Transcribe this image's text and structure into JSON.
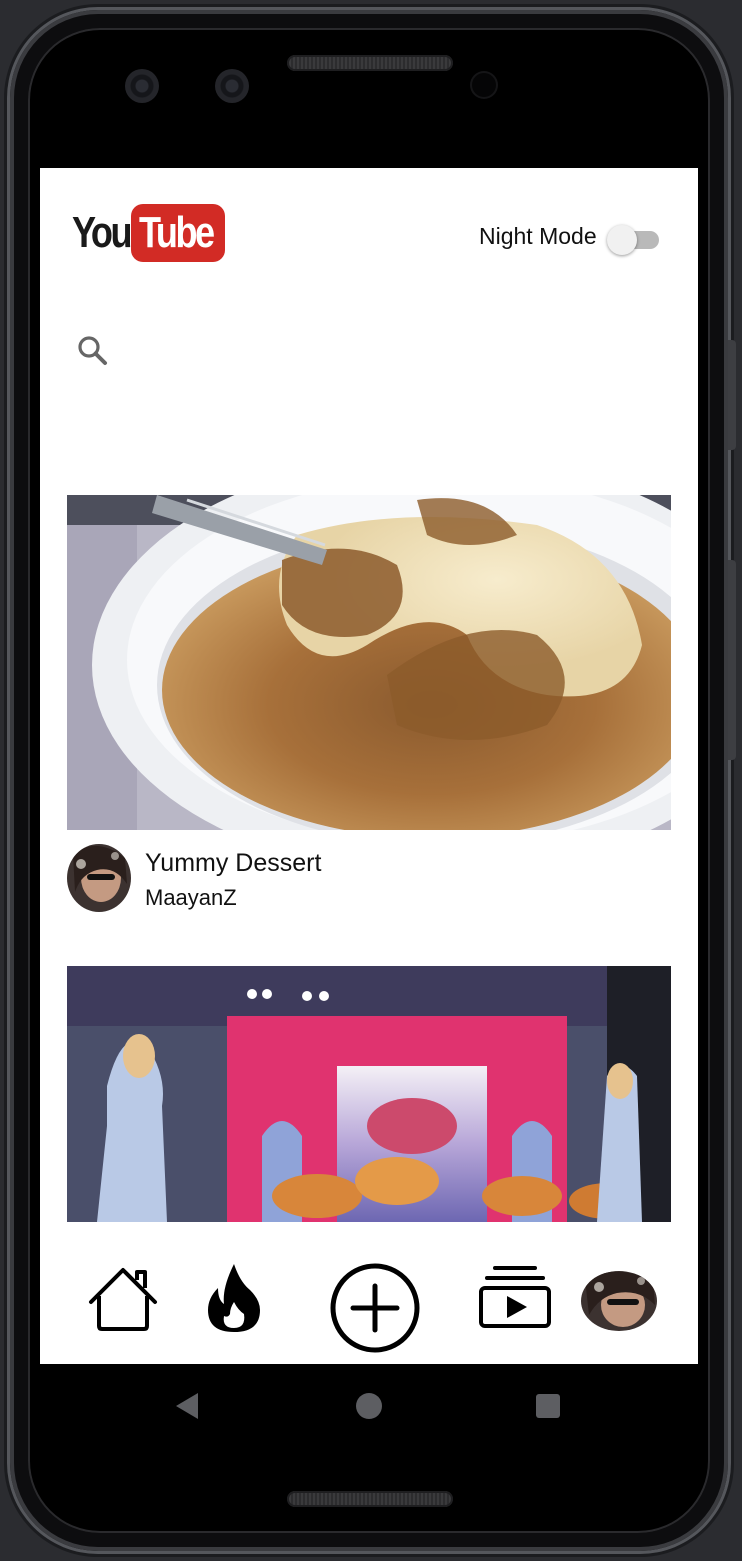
{
  "header": {
    "logo_you": "You",
    "logo_tube": "Tube",
    "night_mode_label": "Night Mode",
    "night_mode_on": false
  },
  "search": {
    "icon": "search-icon",
    "placeholder": ""
  },
  "videos": [
    {
      "title": "Yummy Dessert",
      "author": "MaayanZ",
      "thumbnail": "creme-brulee"
    },
    {
      "title": "",
      "author": "",
      "thumbnail": "concert-stage"
    }
  ],
  "bottom_nav": {
    "items": [
      "home-icon",
      "trending-fire-icon",
      "add-video-icon",
      "subscriptions-icon",
      "profile-avatar"
    ]
  },
  "colors": {
    "brand_red": "#d22b25",
    "toggle_track": "#b9b9b9",
    "app_background": "#ffffff",
    "phone_body": "#0d0d0f"
  }
}
